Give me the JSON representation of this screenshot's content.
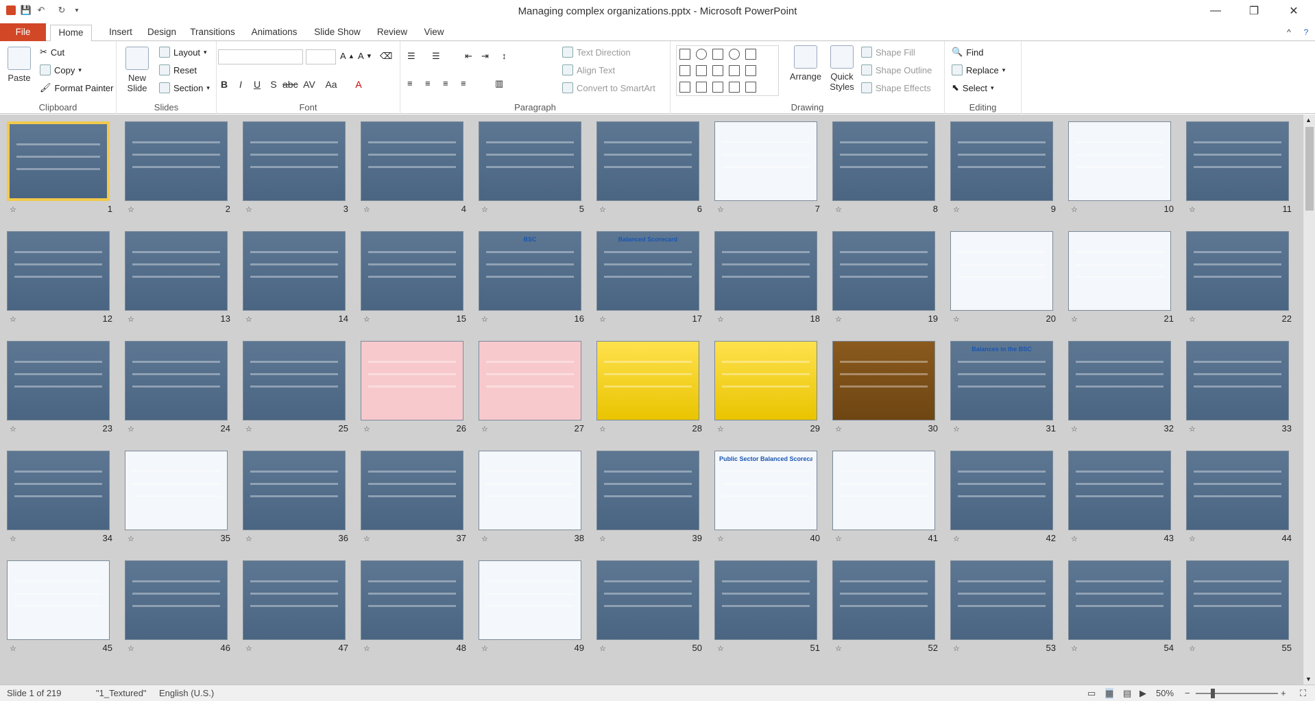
{
  "window": {
    "title": "Managing complex organizations.pptx - Microsoft PowerPoint"
  },
  "tabs": [
    "File",
    "Home",
    "Insert",
    "Design",
    "Transitions",
    "Animations",
    "Slide Show",
    "Review",
    "View"
  ],
  "ribbon": {
    "clipboard": {
      "paste": "Paste",
      "cut": "Cut",
      "copy": "Copy",
      "format_painter": "Format Painter",
      "label": "Clipboard"
    },
    "slides": {
      "new_slide": "New Slide",
      "layout": "Layout",
      "reset": "Reset",
      "section": "Section",
      "label": "Slides"
    },
    "font": {
      "label": "Font",
      "name": "",
      "size": ""
    },
    "paragraph": {
      "text_direction": "Text Direction",
      "align_text": "Align Text",
      "convert_smartart": "Convert to SmartArt",
      "label": "Paragraph"
    },
    "drawing": {
      "arrange": "Arrange",
      "quick_styles": "Quick Styles",
      "shape_fill": "Shape Fill",
      "shape_outline": "Shape Outline",
      "shape_effects": "Shape Effects",
      "label": "Drawing"
    },
    "editing": {
      "find": "Find",
      "replace": "Replace",
      "select": "Select",
      "label": "Editing"
    }
  },
  "slides": [
    {
      "num": "1"
    },
    {
      "num": "2"
    },
    {
      "num": "3"
    },
    {
      "num": "4"
    },
    {
      "num": "5"
    },
    {
      "num": "6"
    },
    {
      "num": "7"
    },
    {
      "num": "8"
    },
    {
      "num": "9"
    },
    {
      "num": "10"
    },
    {
      "num": "11"
    },
    {
      "num": "12"
    },
    {
      "num": "13"
    },
    {
      "num": "14"
    },
    {
      "num": "15"
    },
    {
      "num": "16"
    },
    {
      "num": "17"
    },
    {
      "num": "18"
    },
    {
      "num": "19"
    },
    {
      "num": "20"
    },
    {
      "num": "21"
    },
    {
      "num": "22"
    },
    {
      "num": "23"
    },
    {
      "num": "24"
    },
    {
      "num": "25"
    },
    {
      "num": "26"
    },
    {
      "num": "27"
    },
    {
      "num": "28"
    },
    {
      "num": "29"
    },
    {
      "num": "30"
    },
    {
      "num": "31"
    },
    {
      "num": "32"
    },
    {
      "num": "33"
    },
    {
      "num": "34"
    },
    {
      "num": "35"
    },
    {
      "num": "36"
    },
    {
      "num": "37"
    },
    {
      "num": "38"
    },
    {
      "num": "39"
    },
    {
      "num": "40"
    },
    {
      "num": "41"
    },
    {
      "num": "42"
    },
    {
      "num": "43"
    },
    {
      "num": "44"
    },
    {
      "num": "45"
    },
    {
      "num": "46"
    },
    {
      "num": "47"
    },
    {
      "num": "48"
    },
    {
      "num": "49"
    },
    {
      "num": "50"
    },
    {
      "num": "51"
    },
    {
      "num": "52"
    },
    {
      "num": "53"
    },
    {
      "num": "54"
    },
    {
      "num": "55"
    }
  ],
  "slide_texts": {
    "s16": "BSC",
    "s17": "Balanced Scorecard",
    "s31": "Balances in the BSC",
    "s40": "Public Sector Balanced Scorecard"
  },
  "status": {
    "slide": "Slide 1 of 219",
    "theme": "\"1_Textured\"",
    "language": "English (U.S.)",
    "zoom": "50%"
  }
}
